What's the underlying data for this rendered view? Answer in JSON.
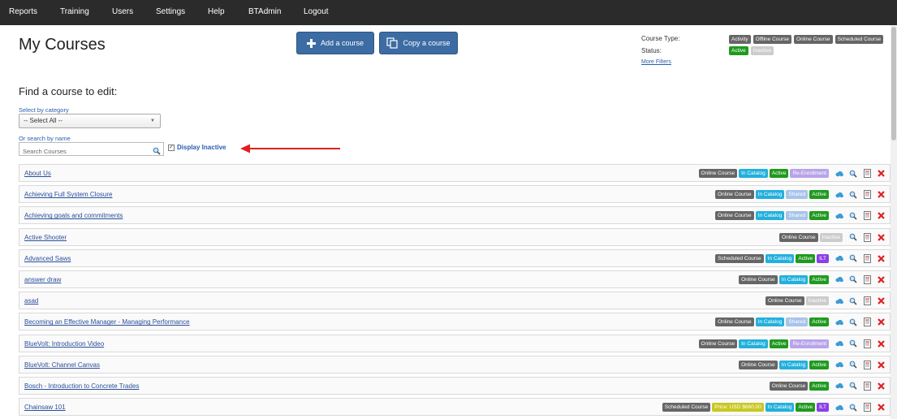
{
  "nav": {
    "items": [
      "Reports",
      "Training",
      "Users",
      "Settings",
      "Help",
      "BTAdmin",
      "Logout"
    ]
  },
  "page": {
    "title": "My Courses",
    "add_course_label": "Add a course",
    "copy_course_label": "Copy a course"
  },
  "filters": {
    "course_type_label": "Course Type:",
    "course_types": [
      "Activity",
      "Offline Course",
      "Online Course",
      "Scheduled Course"
    ],
    "status_label": "Status:",
    "statuses": [
      "Active",
      "Inactive"
    ],
    "more_filters_label": "More Filters"
  },
  "find": {
    "title": "Find a course to edit:",
    "category_label": "Select by category",
    "category_value": "-- Select All --",
    "search_label": "Or search by name",
    "search_placeholder": "Search Courses",
    "display_inactive_label": "Display Inactive",
    "display_inactive_checked": true
  },
  "colors": {
    "nav_bg": "#2b2b2b",
    "primary": "#3c6ca3",
    "link": "#2a5db0",
    "arrow": "#e02020"
  },
  "courses": [
    {
      "name": "About Us",
      "tags": [
        [
          "Online Course",
          "gray"
        ],
        [
          "In Catalog",
          "cyan"
        ],
        [
          "Active",
          "green"
        ],
        [
          "Re-Enrollment",
          "lavender"
        ]
      ],
      "cloud": true
    },
    {
      "name": "Achieving Full System Closure",
      "tags": [
        [
          "Online Course",
          "gray"
        ],
        [
          "In Catalog",
          "cyan"
        ],
        [
          "Shared",
          "lightblue"
        ],
        [
          "Active",
          "green"
        ]
      ],
      "cloud": true
    },
    {
      "name": "Achieving goals and commitments",
      "tags": [
        [
          "Online Course",
          "gray"
        ],
        [
          "In Catalog",
          "cyan"
        ],
        [
          "Shared",
          "lightblue"
        ],
        [
          "Active",
          "green"
        ]
      ],
      "cloud": true
    },
    {
      "name": "Active Shooter",
      "tags": [
        [
          "Online Course",
          "gray"
        ],
        [
          "Inactive",
          "inactive"
        ]
      ],
      "cloud": false
    },
    {
      "name": "Advanced Saws",
      "tags": [
        [
          "Scheduled Course",
          "gray"
        ],
        [
          "In Catalog",
          "cyan"
        ],
        [
          "Active",
          "green"
        ],
        [
          "ILT",
          "purple"
        ]
      ],
      "cloud": true
    },
    {
      "name": "answer draw",
      "tags": [
        [
          "Online Course",
          "gray"
        ],
        [
          "In Catalog",
          "cyan"
        ],
        [
          "Active",
          "green"
        ]
      ],
      "cloud": true
    },
    {
      "name": "asad",
      "tags": [
        [
          "Online Course",
          "gray"
        ],
        [
          "Inactive",
          "inactive"
        ]
      ],
      "cloud": true
    },
    {
      "name": "Becoming an Effective Manager - Managing Performance",
      "tags": [
        [
          "Online Course",
          "gray"
        ],
        [
          "In Catalog",
          "cyan"
        ],
        [
          "Shared",
          "lightblue"
        ],
        [
          "Active",
          "green"
        ]
      ],
      "cloud": true
    },
    {
      "name": "BlueVolt: Introduction Video",
      "tags": [
        [
          "Online Course",
          "gray"
        ],
        [
          "In Catalog",
          "cyan"
        ],
        [
          "Active",
          "green"
        ],
        [
          "Re-Enrollment",
          "lavender"
        ]
      ],
      "cloud": true
    },
    {
      "name": "BlueVolt: Channel Canvas",
      "tags": [
        [
          "Online Course",
          "gray"
        ],
        [
          "In Catalog",
          "cyan"
        ],
        [
          "Active",
          "green"
        ]
      ],
      "cloud": true
    },
    {
      "name": "Bosch - Introduction to Concrete Trades",
      "tags": [
        [
          "Online Course",
          "gray"
        ],
        [
          "Active",
          "green"
        ]
      ],
      "cloud": true
    },
    {
      "name": "Chainsaw 101",
      "tags": [
        [
          "Scheduled Course",
          "gray"
        ],
        [
          "Price: USD $660.00",
          "yellow"
        ],
        [
          "In Catalog",
          "cyan"
        ],
        [
          "Active",
          "green"
        ],
        [
          "ILT",
          "purple"
        ]
      ],
      "cloud": true
    }
  ]
}
